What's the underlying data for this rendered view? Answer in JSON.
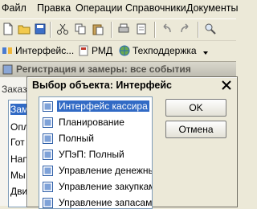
{
  "menu": {
    "items": [
      "Файл",
      "Правка",
      "Операции",
      "Справочники",
      "Документы"
    ]
  },
  "toolbar2": {
    "interface_label": "Интерфейс...",
    "rmd_label": "РМД",
    "support_label": "Техподдержка"
  },
  "background_window": {
    "title": "Регистрация и замеры: все события",
    "tab_label": "Заказ",
    "rows": [
      "Зам",
      "Опл",
      "Гот",
      "Нап",
      "Мы",
      "Дви"
    ]
  },
  "dialog": {
    "title": "Выбор объекта: Интерфейс",
    "items": [
      "Интерфейс кассира",
      "Планирование",
      "Полный",
      "УПэП: Полный",
      "Управление денежны",
      "Управление закупкам",
      "Управление запасами"
    ],
    "selected_index": 0,
    "ok_label": "OK",
    "cancel_label": "Отмена"
  },
  "colors": {
    "selection": "#316ac5",
    "window_bg": "#ece9d8"
  }
}
